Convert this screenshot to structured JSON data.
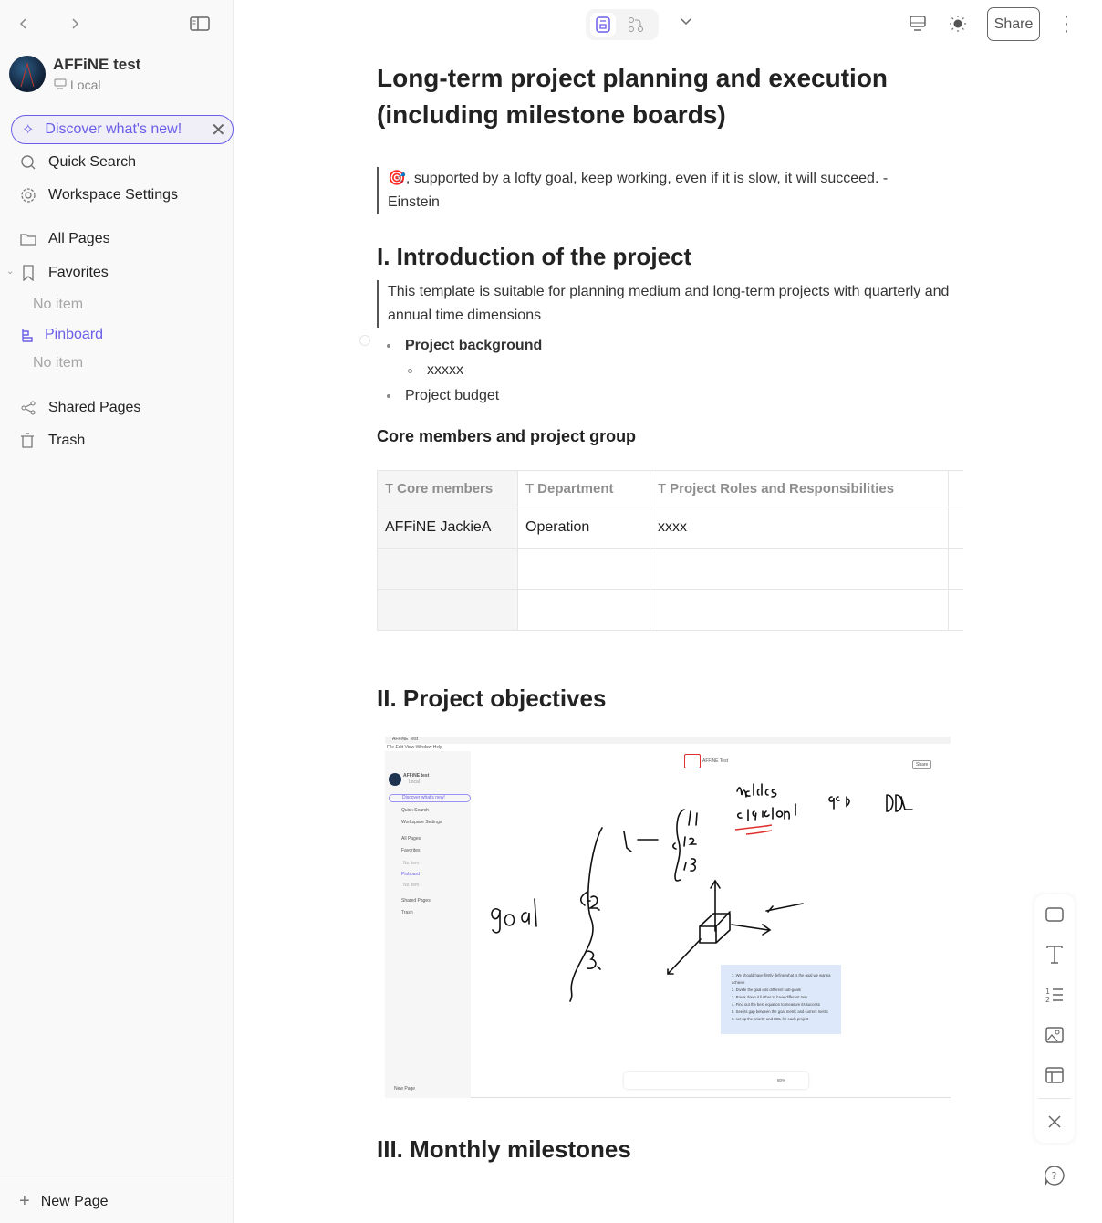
{
  "sidebar": {
    "workspace_name": "AFFiNE test",
    "workspace_type": "Local",
    "discover": "Discover what's new!",
    "items": [
      {
        "label": "Quick Search",
        "icon": "search-icon"
      },
      {
        "label": "Workspace Settings",
        "icon": "gear-icon"
      },
      {
        "label": "All Pages",
        "icon": "folder-icon"
      },
      {
        "label": "Favorites",
        "icon": "bookmark-icon"
      },
      {
        "label": "No item"
      },
      {
        "label": "Pinboard",
        "icon": "pinboard-icon"
      },
      {
        "label": "No item"
      },
      {
        "label": "Shared Pages",
        "icon": "share-icon"
      },
      {
        "label": "Trash",
        "icon": "trash-icon"
      }
    ],
    "new_page": "New Page",
    "accent": "#6a5ee8"
  },
  "header": {
    "share": "Share"
  },
  "doc": {
    "title": "Long-term project planning and execution (including milestone boards)",
    "quote1": ", supported by a lofty goal, keep working, even if it is slow, it will succeed. - Einstein",
    "quote1_emoji": "🎯",
    "h_intro": "I. Introduction of the project",
    "quote2": "This template is suitable for planning medium and long-term projects with quarterly and annual time dimensions",
    "bullet1": "Project background",
    "sub1": "xxxxx",
    "bullet2": "Project budget",
    "h_core": "Core members and project group",
    "table": {
      "headers": [
        "Core members",
        "Department",
        "Project Roles and Responsibilities"
      ],
      "rows": [
        [
          "AFFiNE JackieA",
          "Operation",
          "xxxx"
        ],
        [
          "",
          "",
          ""
        ],
        [
          "",
          "",
          ""
        ]
      ]
    },
    "h_obj": "II. Project objectives",
    "h_month": "III. Monthly milestones"
  },
  "embedded": {
    "window_title": "AFFiNE Test",
    "menu": "File  Edit  View  Window  Help",
    "doc_title": "AFFiNE Test",
    "workspace": "AFFiNE test",
    "local": "Local",
    "discover": "Discover what's new!",
    "items": [
      "Quick Search",
      "Workspace Settings",
      "All Pages",
      "Favorites",
      "No item",
      "Pinboard",
      "No item",
      "Shared Pages",
      "Trash"
    ],
    "new_page": "New Page",
    "share": "Share",
    "zoom": "80%",
    "note": [
      "We should have firstly define what is the goal we wanna achieve",
      "Divide the goal into different sub-goals",
      "Break down it further to have different task",
      "Find out the best equation to measure its success",
      "See its gap between the goal metric and current metric",
      "set up the priority and DDL for each project"
    ]
  }
}
